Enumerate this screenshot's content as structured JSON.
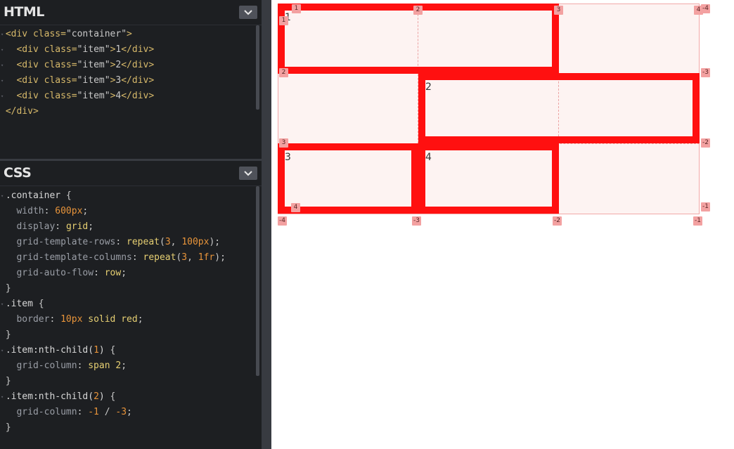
{
  "html_panel": {
    "title": "HTML",
    "lines": [
      [
        {
          "t": "<div ",
          "c": "tag"
        },
        {
          "t": "class=",
          "c": "attr"
        },
        {
          "t": "\"container\"",
          "c": "str"
        },
        {
          "t": ">",
          "c": "tag"
        }
      ],
      [
        {
          "t": "  <div ",
          "c": "tag"
        },
        {
          "t": "class=",
          "c": "attr"
        },
        {
          "t": "\"item\"",
          "c": "str"
        },
        {
          "t": ">",
          "c": "tag"
        },
        {
          "t": "1",
          "c": "punc"
        },
        {
          "t": "</div>",
          "c": "tag"
        }
      ],
      [
        {
          "t": "  <div ",
          "c": "tag"
        },
        {
          "t": "class=",
          "c": "attr"
        },
        {
          "t": "\"item\"",
          "c": "str"
        },
        {
          "t": ">",
          "c": "tag"
        },
        {
          "t": "2",
          "c": "punc"
        },
        {
          "t": "</div>",
          "c": "tag"
        }
      ],
      [
        {
          "t": "  <div ",
          "c": "tag"
        },
        {
          "t": "class=",
          "c": "attr"
        },
        {
          "t": "\"item\"",
          "c": "str"
        },
        {
          "t": ">",
          "c": "tag"
        },
        {
          "t": "3",
          "c": "punc"
        },
        {
          "t": "</div>",
          "c": "tag"
        }
      ],
      [
        {
          "t": "  <div ",
          "c": "tag"
        },
        {
          "t": "class=",
          "c": "attr"
        },
        {
          "t": "\"item\"",
          "c": "str"
        },
        {
          "t": ">",
          "c": "tag"
        },
        {
          "t": "4",
          "c": "punc"
        },
        {
          "t": "</div>",
          "c": "tag"
        }
      ],
      [
        {
          "t": "</div>",
          "c": "tag"
        }
      ]
    ]
  },
  "css_panel": {
    "title": "CSS",
    "lines": [
      [
        {
          "t": ".container ",
          "c": "sel"
        },
        {
          "t": "{",
          "c": "punc"
        }
      ],
      [
        {
          "t": "  width",
          "c": "prop"
        },
        {
          "t": ": ",
          "c": "punc"
        },
        {
          "t": "600px",
          "c": "num"
        },
        {
          "t": ";",
          "c": "punc"
        }
      ],
      [
        {
          "t": "  display",
          "c": "prop"
        },
        {
          "t": ": ",
          "c": "punc"
        },
        {
          "t": "grid",
          "c": "kw"
        },
        {
          "t": ";",
          "c": "punc"
        }
      ],
      [
        {
          "t": "  grid-template-rows",
          "c": "prop"
        },
        {
          "t": ": ",
          "c": "punc"
        },
        {
          "t": "repeat",
          "c": "kw"
        },
        {
          "t": "(",
          "c": "punc"
        },
        {
          "t": "3",
          "c": "num"
        },
        {
          "t": ", ",
          "c": "punc"
        },
        {
          "t": "100px",
          "c": "num"
        },
        {
          "t": ");",
          "c": "punc"
        }
      ],
      [
        {
          "t": "  grid-template-columns",
          "c": "prop"
        },
        {
          "t": ": ",
          "c": "punc"
        },
        {
          "t": "repeat",
          "c": "kw"
        },
        {
          "t": "(",
          "c": "punc"
        },
        {
          "t": "3",
          "c": "num"
        },
        {
          "t": ", ",
          "c": "punc"
        },
        {
          "t": "1fr",
          "c": "num"
        },
        {
          "t": ");",
          "c": "punc"
        }
      ],
      [
        {
          "t": "  grid-auto-flow",
          "c": "prop"
        },
        {
          "t": ": ",
          "c": "punc"
        },
        {
          "t": "row",
          "c": "kw"
        },
        {
          "t": ";",
          "c": "punc"
        }
      ],
      [
        {
          "t": "}",
          "c": "punc"
        }
      ],
      [
        {
          "t": ".item ",
          "c": "sel"
        },
        {
          "t": "{",
          "c": "punc"
        }
      ],
      [
        {
          "t": "  border",
          "c": "prop"
        },
        {
          "t": ": ",
          "c": "punc"
        },
        {
          "t": "10px",
          "c": "num"
        },
        {
          "t": " solid red",
          "c": "kw"
        },
        {
          "t": ";",
          "c": "punc"
        }
      ],
      [
        {
          "t": "}",
          "c": "punc"
        }
      ],
      [
        {
          "t": ".item:nth-child(",
          "c": "sel"
        },
        {
          "t": "1",
          "c": "num"
        },
        {
          "t": ") ",
          "c": "sel"
        },
        {
          "t": "{",
          "c": "punc"
        }
      ],
      [
        {
          "t": "  grid-column",
          "c": "prop"
        },
        {
          "t": ": ",
          "c": "punc"
        },
        {
          "t": "span 2",
          "c": "kw"
        },
        {
          "t": ";",
          "c": "punc"
        }
      ],
      [
        {
          "t": "}",
          "c": "punc"
        }
      ],
      [
        {
          "t": ".item:nth-child(",
          "c": "sel"
        },
        {
          "t": "2",
          "c": "num"
        },
        {
          "t": ") ",
          "c": "sel"
        },
        {
          "t": "{",
          "c": "punc"
        }
      ],
      [
        {
          "t": "  grid-column",
          "c": "prop"
        },
        {
          "t": ": ",
          "c": "punc"
        },
        {
          "t": "-1",
          "c": "num"
        },
        {
          "t": " / ",
          "c": "punc"
        },
        {
          "t": "-3",
          "c": "num"
        },
        {
          "t": ";",
          "c": "punc"
        }
      ],
      [
        {
          "t": "}",
          "c": "punc"
        }
      ]
    ]
  },
  "preview": {
    "items": [
      "1",
      "2",
      "3",
      "4"
    ],
    "badges": {
      "col_top": [
        "1",
        "2",
        "3",
        "4"
      ],
      "col_bottom": [
        "-4",
        "-3",
        "-2",
        "-1"
      ],
      "row_left": [
        "1",
        "2",
        "3",
        "4"
      ],
      "row_right": [
        "-4",
        "-3",
        "-2",
        "-1"
      ]
    }
  },
  "colors": {
    "item_border": "#ff1010",
    "grid_bg": "#fdf3f2",
    "badge_bg": "#f3a1a1",
    "editor_bg": "#1d1f22"
  }
}
